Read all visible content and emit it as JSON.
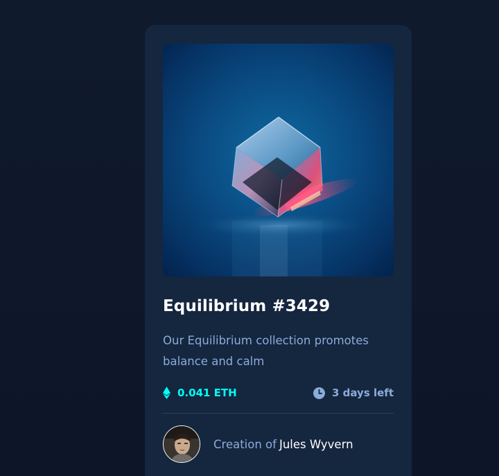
{
  "card": {
    "title": "Equilibrium #3429",
    "description": "Our Equilibrium collection promotes balance and calm",
    "price": "0.041 ETH",
    "time_left": "3 days left",
    "creator_prefix": "Creation of",
    "creator_name": "Jules Wyvern"
  },
  "icons": {
    "price": "ethereum-icon",
    "time": "clock-icon"
  },
  "colors": {
    "page_bg": "#0e1729",
    "card_bg": "#15263f",
    "accent_cyan": "#00fff8",
    "soft_blue": "#8bacd9",
    "white": "#ffffff",
    "divider": "#2e405a"
  }
}
